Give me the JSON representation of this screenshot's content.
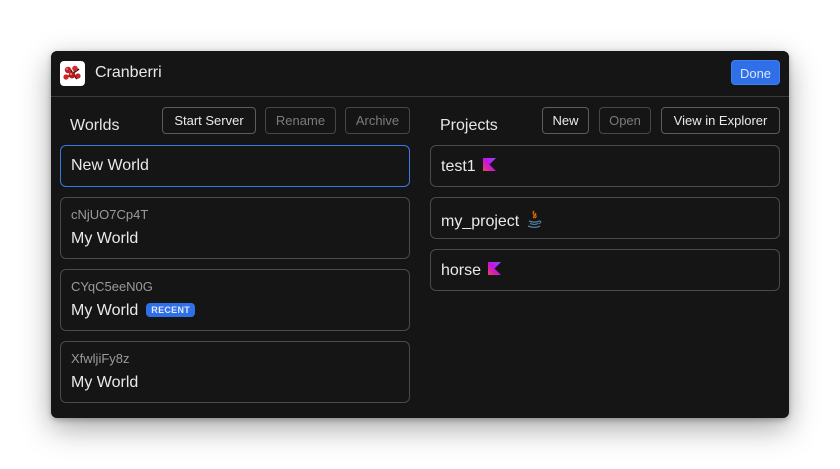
{
  "app": {
    "title": "Cranberri",
    "done_label": "Done",
    "icon": "cranberry-logo-icon"
  },
  "worlds": {
    "title": "Worlds",
    "buttons": {
      "start_server": "Start Server",
      "rename": "Rename",
      "archive": "Archive"
    },
    "new_world_label": "New World",
    "items": [
      {
        "id": "cNjUO7Cp4T",
        "name": "My World",
        "badge": ""
      },
      {
        "id": "CYqC5eeN0G",
        "name": "My World",
        "badge": "RECENT"
      },
      {
        "id": "XfwljiFy8z",
        "name": "My World",
        "badge": ""
      }
    ]
  },
  "projects": {
    "title": "Projects",
    "buttons": {
      "new": "New",
      "open": "Open",
      "explorer": "View in Explorer"
    },
    "items": [
      {
        "name": "test1",
        "icon": "kotlin-icon"
      },
      {
        "name": "my_project",
        "icon": "java-icon"
      },
      {
        "name": "horse",
        "icon": "kotlin-icon"
      }
    ]
  },
  "colors": {
    "accent": "#2f6fe8",
    "background": "#151515",
    "border": "#4a4a4a"
  }
}
